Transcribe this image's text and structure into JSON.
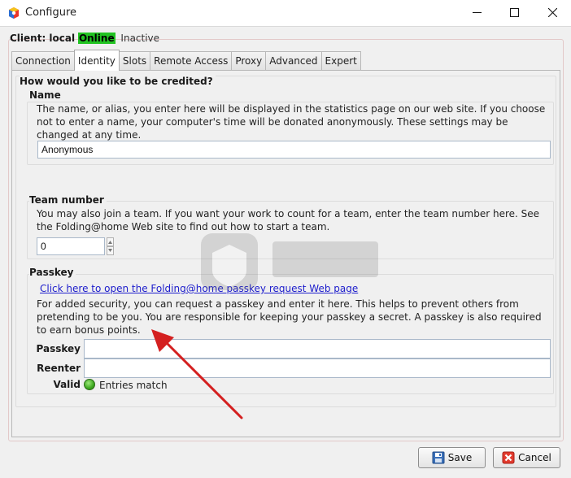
{
  "window": {
    "title": "Configure",
    "minimize_icon": "minimize-icon",
    "maximize_icon": "maximize-icon",
    "close_icon": "close-icon"
  },
  "client": {
    "label": "Client: local",
    "status": "Online",
    "status_color": "#22c322",
    "state": "Inactive"
  },
  "tabs": [
    {
      "label": "Connection"
    },
    {
      "label": "Identity",
      "active": true
    },
    {
      "label": "Slots"
    },
    {
      "label": "Remote Access"
    },
    {
      "label": "Proxy"
    },
    {
      "label": "Advanced"
    },
    {
      "label": "Expert"
    }
  ],
  "identity": {
    "heading": "How would you like to be credited?",
    "name": {
      "title": "Name",
      "description": "The name, or alias, you enter here will be displayed in the statistics page on our web site.  If you choose not to enter a name, your computer's time will be donated anonymously.  These settings may be changed at any time.",
      "value": "Anonymous"
    },
    "team": {
      "title": "Team number",
      "description": "You may also join a team.  If you want your work to count for a team, enter the team number here.  See the Folding@home Web site to find out how to start a team.",
      "value": "0"
    },
    "passkey": {
      "title": "Passkey",
      "link_text": "Click here to open the Folding@home passkey request Web page",
      "description": "For added security, you can request a passkey and enter it here.  This helps to prevent others from pretending to be you.  You are responsible for keeping your passkey a secret.  A passkey is also required to earn bonus points.",
      "passkey_label": "Passkey",
      "passkey_value": "",
      "reenter_label": "Reenter",
      "reenter_value": "",
      "valid_label": "Valid",
      "valid_text": "Entries match",
      "valid_color": "#3da81f"
    }
  },
  "buttons": {
    "save": "Save",
    "cancel": "Cancel"
  },
  "annotation": {
    "arrow_color": "#d42020"
  }
}
